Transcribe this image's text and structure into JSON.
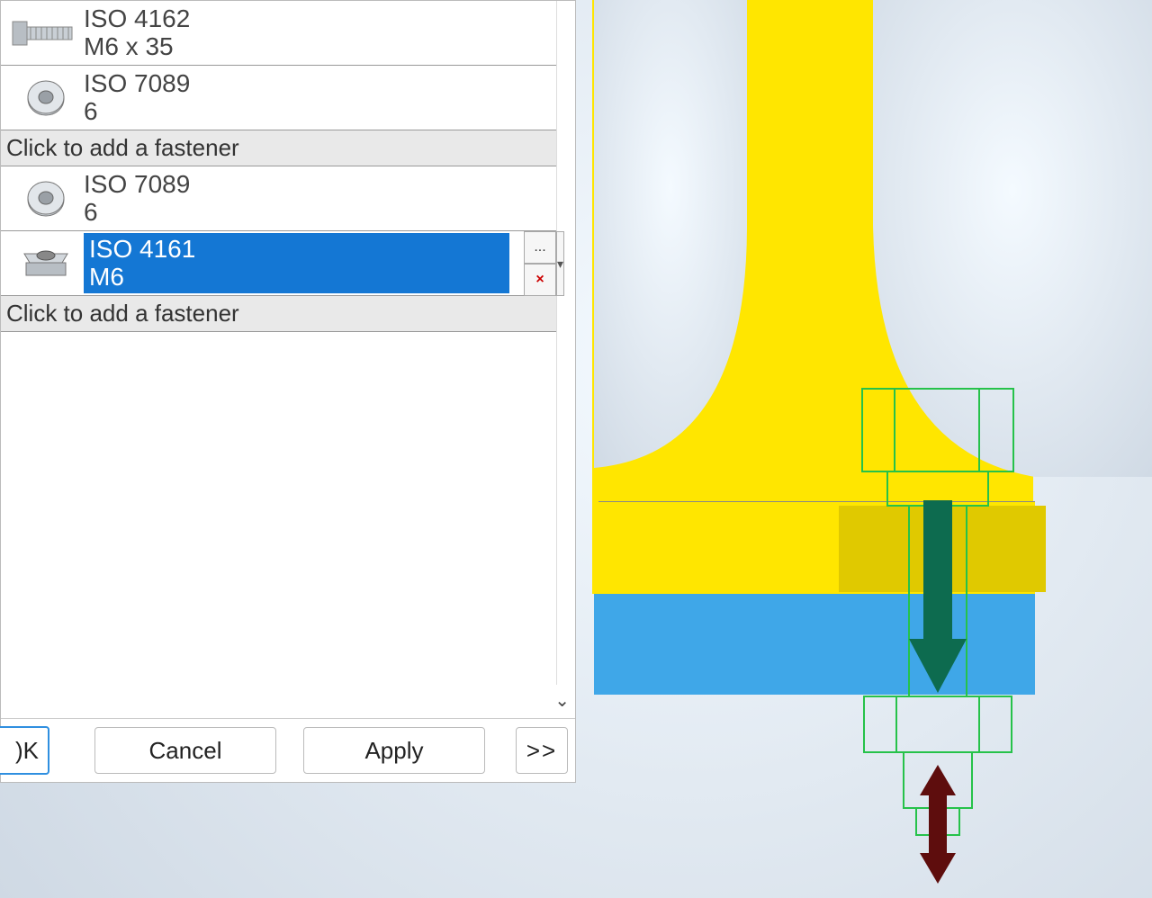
{
  "fasteners": {
    "items": [
      {
        "standard": "ISO 4162",
        "size": "M6 x 35",
        "icon": "bolt-icon",
        "selected": false
      },
      {
        "standard": "ISO 7089",
        "size": "6",
        "icon": "washer-icon",
        "selected": false
      },
      {
        "standard": "ISO 7089",
        "size": "6",
        "icon": "washer-icon",
        "selected": false
      },
      {
        "standard": "ISO 4161",
        "size": "M6",
        "icon": "nut-icon",
        "selected": true
      }
    ],
    "add_prompt": "Click to add a fastener",
    "more_label": "...",
    "delete_label": "×",
    "dropdown_label": "▾"
  },
  "buttons": {
    "ok": ")K",
    "cancel": "Cancel",
    "apply": "Apply",
    "more": ">>"
  },
  "collapse_chevron": "⌄"
}
